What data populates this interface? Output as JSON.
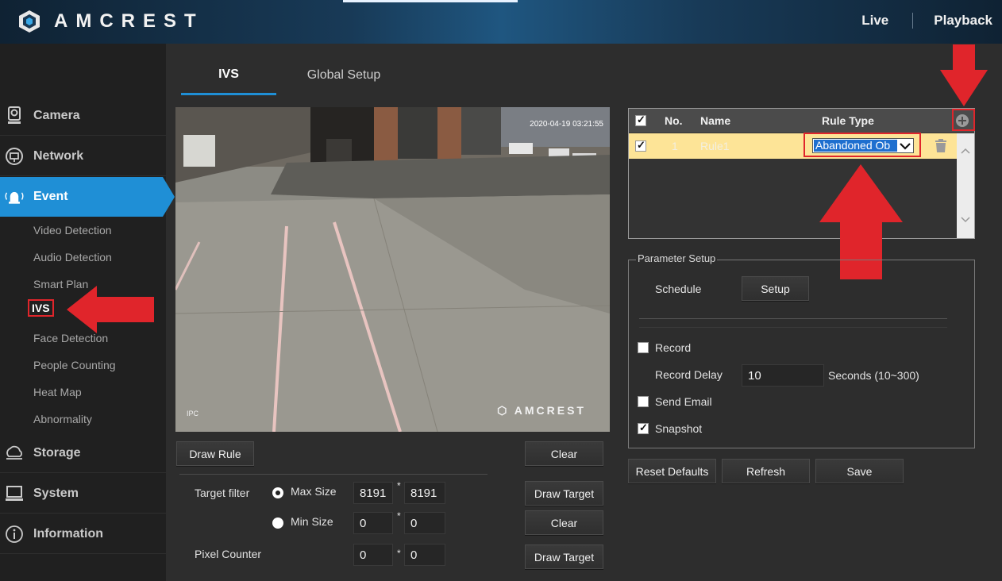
{
  "header": {
    "brand": "AMCREST",
    "nav": {
      "live": "Live",
      "playback": "Playback"
    }
  },
  "sidebar": {
    "items": [
      {
        "label": "Camera",
        "icon": "camera-icon"
      },
      {
        "label": "Network",
        "icon": "network-icon"
      },
      {
        "label": "Event",
        "icon": "event-alarm-icon",
        "active": true
      },
      {
        "label": "Storage",
        "icon": "storage-icon"
      },
      {
        "label": "System",
        "icon": "system-monitor-icon"
      },
      {
        "label": "Information",
        "icon": "info-icon"
      }
    ],
    "event_subitems": [
      "Video Detection",
      "Audio Detection",
      "Smart Plan",
      "IVS",
      "Face Detection",
      "People Counting",
      "Heat Map",
      "Abnormality"
    ],
    "current_subitem": "IVS"
  },
  "tabs": {
    "ivs": "IVS",
    "global_setup": "Global Setup"
  },
  "video": {
    "watermark": "AMCREST",
    "timestamp": "2020-04-19 03:21:55",
    "channel": "IPC"
  },
  "controls": {
    "draw_rule": "Draw Rule",
    "clear": "Clear",
    "draw_target": "Draw Target",
    "target_filter": "Target filter",
    "max_size": "Max Size",
    "min_size": "Min Size",
    "pixel_counter": "Pixel Counter",
    "times": "*",
    "max_w": "8191",
    "max_h": "8191",
    "min_w": "0",
    "min_h": "0",
    "pix_w": "0",
    "pix_h": "0"
  },
  "rule_table": {
    "headers": {
      "no": "No.",
      "name": "Name",
      "rule_type": "Rule Type"
    },
    "rows": [
      {
        "no": "1",
        "name": "Rule1",
        "rule_type": "Abandoned Object",
        "rule_type_visible": "Abandoned Ob"
      }
    ]
  },
  "parameter_setup": {
    "legend": "Parameter Setup",
    "schedule": "Schedule",
    "setup": "Setup",
    "record": "Record",
    "record_delay": "Record Delay",
    "record_delay_value": "10",
    "record_delay_unit": "Seconds (10~300)",
    "send_email": "Send Email",
    "snapshot": "Snapshot"
  },
  "actions": {
    "reset_defaults": "Reset Defaults",
    "refresh": "Refresh",
    "save": "Save"
  },
  "colors": {
    "accent": "#1f8fd6",
    "annotation": "#e0252b",
    "selected_row": "#fde497"
  }
}
